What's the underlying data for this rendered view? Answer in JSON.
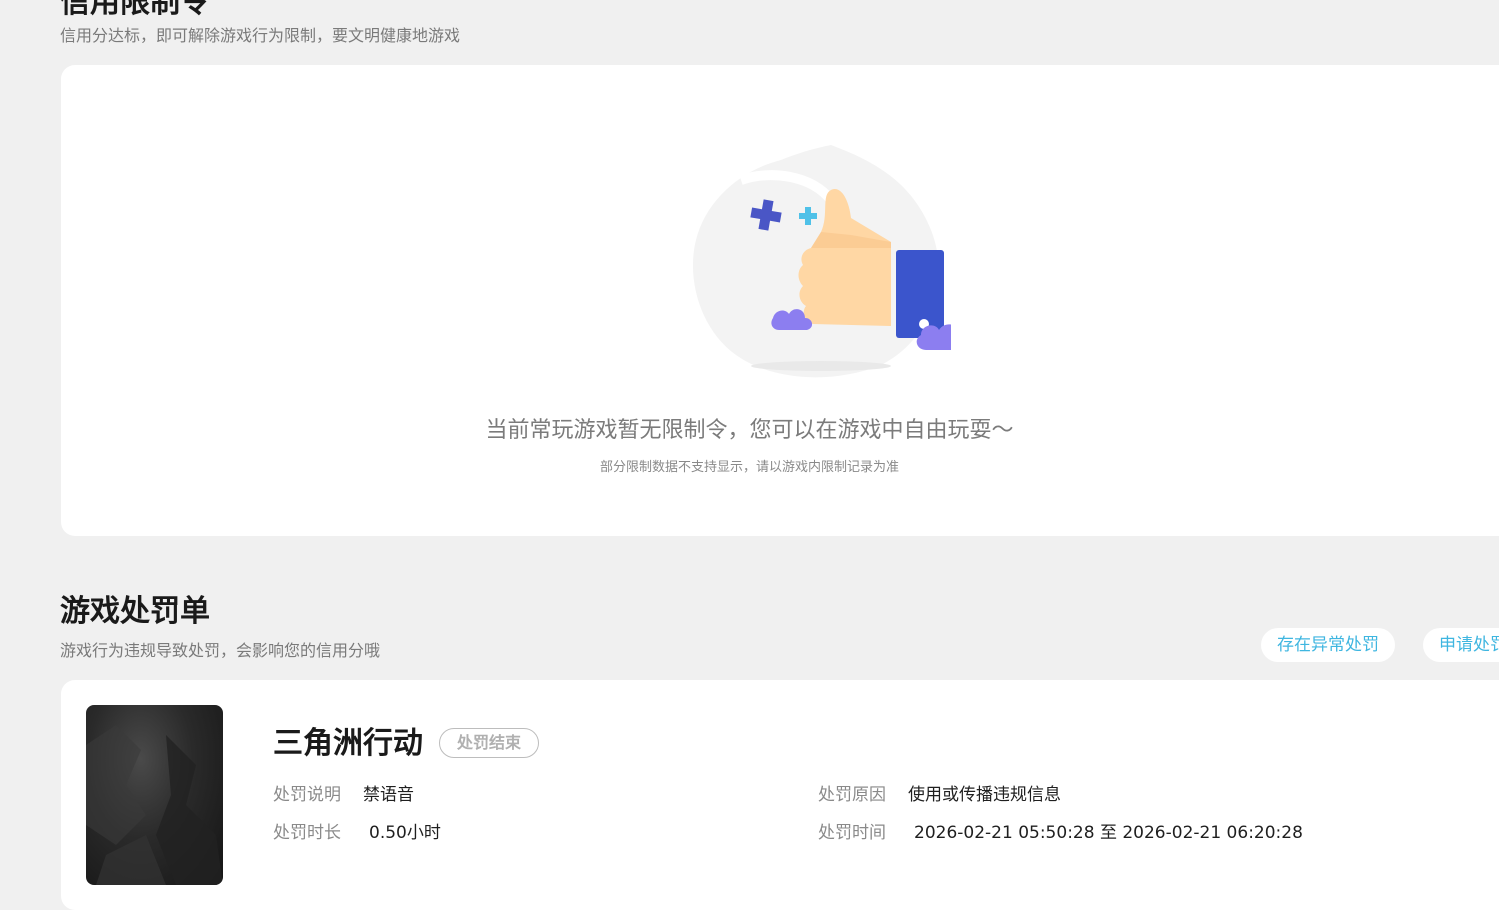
{
  "credit_restriction": {
    "title": "信用限制令",
    "subtitle": "信用分达标，即可解除游戏行为限制，要文明健康地游戏",
    "empty_message": "当前常玩游戏暂无限制令，您可以在游戏中自由玩耍～",
    "empty_note": "部分限制数据不支持显示，请以游戏内限制记录为准"
  },
  "penalty_list": {
    "title": "游戏处罚单",
    "subtitle": "游戏行为违规导致处罚，会影响您的信用分哦",
    "abnormal_button": "存在异常处罚",
    "apply_button": "申请处罚",
    "items": [
      {
        "game": "三角洲行动",
        "status": "处罚结束",
        "desc_label": "处罚说明",
        "desc_value": "禁语音",
        "reason_label": "处罚原因",
        "reason_value": "使用或传播违规信息",
        "duration_label": "处罚时长",
        "duration_value": "0.50小时",
        "time_label": "处罚时间",
        "time_value": "2026-02-21 05:50:28 至 2026-02-21 06:20:28"
      }
    ]
  },
  "colors": {
    "accent": "#3fb6e0",
    "background": "#f0f0f0",
    "card": "#ffffff",
    "thumb_blue": "#3b55cc"
  },
  "icons": [
    "thumbs-up-illustration",
    "sparkle-icon",
    "cloud-icon"
  ]
}
